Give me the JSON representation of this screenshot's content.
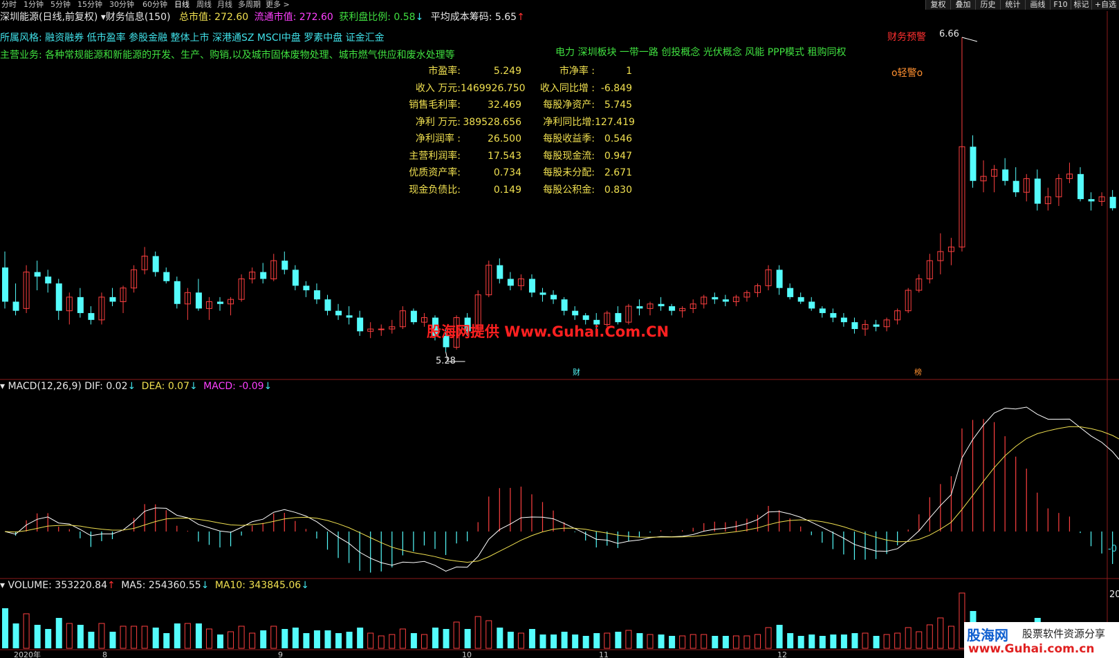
{
  "periods": [
    "分时",
    "1分钟",
    "5分钟",
    "15分钟",
    "30分钟",
    "60分钟",
    "日线",
    "周线",
    "月线",
    "多周期",
    "更多 >"
  ],
  "active_period": "日线",
  "toolbar": [
    "复权",
    "叠加",
    "历史",
    "统计",
    "画线",
    "F10",
    "标记",
    "+自选"
  ],
  "header": {
    "stock": "深圳能源(日线,前复权)",
    "finance_tab": "财务信息(150)",
    "total_mv_label": "总市值:",
    "total_mv": "272.60",
    "float_mv_label": "流通市值:",
    "float_mv": "272.60",
    "profit_ratio_label": "获利盘比例:",
    "profit_ratio": "0.58",
    "avg_cost_label": "平均成本筹码:",
    "avg_cost": "5.65",
    "arrow_down": "↓",
    "arrow_up": "↑"
  },
  "style_row": {
    "label": "所属风格:",
    "value": "融资融券 低市盈率 参股金融 整体上市 深港通SZ MSCI中盘 罗素中盘 证金汇金"
  },
  "business_row": {
    "label": "主营业务:",
    "value": "各种常规能源和新能源的开发、生产、购销,以及城市固体废物处理、城市燃气供应和废水处理等"
  },
  "concepts": "电力 深圳板块 一带一路 创投概念 光伏概念 风能 PPP模式 租购同权",
  "financials": [
    {
      "l1": "市盈率:",
      "v1": "5.249",
      "l2": "市净率 :",
      "v2": "1"
    },
    {
      "l1": "收入 万元:",
      "v1": "1469926.750",
      "l2": "收入同比增 :",
      "v2": "-6.849"
    },
    {
      "l1": "销售毛利率:",
      "v1": "32.469",
      "l2": "每股净资产:",
      "v2": "5.745"
    },
    {
      "l1": "净利 万元:",
      "v1": "389528.656",
      "l2": "净利同比增:",
      "v2": "127.419"
    },
    {
      "l1": "净利润率 :",
      "v1": "26.500",
      "l2": "每股收益季:",
      "v2": "0.546"
    },
    {
      "l1": "主营利润率:",
      "v1": "17.543",
      "l2": "每股现金流:",
      "v2": "0.947"
    },
    {
      "l1": "优质资产率:",
      "v1": "0.734",
      "l2": "每股未分配:",
      "v2": "2.671"
    },
    {
      "l1": "现金负债比:",
      "v1": "0.149",
      "l2": "每股公积金:",
      "v2": "0.830"
    }
  ],
  "annotations": {
    "warning": "财务预警",
    "high": "6.66",
    "light_warning": "o轻警o",
    "low": "5.28",
    "fin_marker": "财",
    "list_marker": "榜",
    "watermark": "股海网提供 Www.Guhai.Com.CN"
  },
  "macd": {
    "title": "MACD(12,26,9)",
    "dif_label": "DIF:",
    "dif": "0.02",
    "dea_label": "DEA:",
    "dea": "0.07",
    "macd_label": "MACD:",
    "macd": "-0.09",
    "axis": "-0"
  },
  "volume": {
    "title": "VOLUME:",
    "value": "353220.84",
    "ma5_label": "MA5:",
    "ma5": "254360.55",
    "ma10_label": "MA10:",
    "ma10": "343845.06",
    "axis": "20"
  },
  "x_axis": [
    "2020年",
    "8",
    "9",
    "10",
    "11",
    "12"
  ],
  "logo": {
    "main": "股海网",
    "slogan": "股票软件资源分享",
    "url": "www.Guhai.com.cn"
  },
  "colors": {
    "up": "#ff4040",
    "down": "#54fcfc",
    "dif": "#ffffff",
    "dea": "#f0e050",
    "macd": "#ff40ff"
  },
  "chart_data": {
    "type": "candlestick",
    "price_high": 6.66,
    "price_low": 5.28,
    "ohlc": [
      [
        5.65,
        5.72,
        5.47,
        5.5
      ],
      [
        5.5,
        5.58,
        5.44,
        5.46
      ],
      [
        5.47,
        5.66,
        5.45,
        5.63
      ],
      [
        5.63,
        5.68,
        5.55,
        5.61
      ],
      [
        5.61,
        5.64,
        5.54,
        5.58
      ],
      [
        5.58,
        5.6,
        5.42,
        5.46
      ],
      [
        5.46,
        5.54,
        5.4,
        5.52
      ],
      [
        5.52,
        5.56,
        5.43,
        5.45
      ],
      [
        5.45,
        5.48,
        5.4,
        5.42
      ],
      [
        5.42,
        5.54,
        5.4,
        5.52
      ],
      [
        5.52,
        5.56,
        5.48,
        5.5
      ],
      [
        5.5,
        5.57,
        5.45,
        5.56
      ],
      [
        5.56,
        5.66,
        5.54,
        5.64
      ],
      [
        5.64,
        5.74,
        5.62,
        5.7
      ],
      [
        5.7,
        5.72,
        5.61,
        5.63
      ],
      [
        5.63,
        5.65,
        5.58,
        5.59
      ],
      [
        5.59,
        5.61,
        5.47,
        5.49
      ],
      [
        5.49,
        5.56,
        5.42,
        5.54
      ],
      [
        5.54,
        5.6,
        5.46,
        5.47
      ],
      [
        5.47,
        5.52,
        5.42,
        5.5
      ],
      [
        5.5,
        5.52,
        5.46,
        5.49
      ],
      [
        5.49,
        5.52,
        5.44,
        5.51
      ],
      [
        5.51,
        5.62,
        5.5,
        5.6
      ],
      [
        5.6,
        5.65,
        5.58,
        5.63
      ],
      [
        5.63,
        5.67,
        5.58,
        5.6
      ],
      [
        5.6,
        5.71,
        5.59,
        5.68
      ],
      [
        5.68,
        5.72,
        5.62,
        5.64
      ],
      [
        5.64,
        5.66,
        5.55,
        5.57
      ],
      [
        5.57,
        5.59,
        5.52,
        5.55
      ],
      [
        5.55,
        5.58,
        5.49,
        5.51
      ],
      [
        5.51,
        5.53,
        5.44,
        5.46
      ],
      [
        5.46,
        5.49,
        5.42,
        5.44
      ],
      [
        5.44,
        5.48,
        5.4,
        5.43
      ],
      [
        5.43,
        5.46,
        5.35,
        5.37
      ],
      [
        5.37,
        5.41,
        5.34,
        5.38
      ],
      [
        5.38,
        5.4,
        5.35,
        5.38
      ],
      [
        5.38,
        5.42,
        5.36,
        5.39
      ],
      [
        5.39,
        5.48,
        5.38,
        5.46
      ],
      [
        5.46,
        5.47,
        5.4,
        5.41
      ],
      [
        5.41,
        5.45,
        5.39,
        5.43
      ],
      [
        5.43,
        5.44,
        5.33,
        5.35
      ],
      [
        5.35,
        5.38,
        5.28,
        5.3
      ],
      [
        5.3,
        5.44,
        5.29,
        5.43
      ],
      [
        5.43,
        5.45,
        5.35,
        5.37
      ],
      [
        5.37,
        5.55,
        5.36,
        5.53
      ],
      [
        5.53,
        5.68,
        5.52,
        5.66
      ],
      [
        5.66,
        5.69,
        5.58,
        5.6
      ],
      [
        5.6,
        5.63,
        5.55,
        5.57
      ],
      [
        5.57,
        5.62,
        5.55,
        5.6
      ],
      [
        5.6,
        5.62,
        5.52,
        5.54
      ],
      [
        5.54,
        5.56,
        5.5,
        5.53
      ],
      [
        5.53,
        5.55,
        5.49,
        5.51
      ],
      [
        5.51,
        5.52,
        5.44,
        5.46
      ],
      [
        5.46,
        5.48,
        5.42,
        5.44
      ],
      [
        5.44,
        5.45,
        5.4,
        5.42
      ],
      [
        5.42,
        5.45,
        5.38,
        5.4
      ],
      [
        5.4,
        5.46,
        5.39,
        5.45
      ],
      [
        5.45,
        5.48,
        5.4,
        5.41
      ],
      [
        5.41,
        5.49,
        5.4,
        5.48
      ],
      [
        5.48,
        5.51,
        5.44,
        5.47
      ],
      [
        5.47,
        5.5,
        5.44,
        5.49
      ],
      [
        5.49,
        5.52,
        5.46,
        5.48
      ],
      [
        5.48,
        5.49,
        5.44,
        5.46
      ],
      [
        5.46,
        5.48,
        5.43,
        5.47
      ],
      [
        5.47,
        5.51,
        5.45,
        5.49
      ],
      [
        5.49,
        5.53,
        5.47,
        5.52
      ],
      [
        5.52,
        5.54,
        5.49,
        5.51
      ],
      [
        5.51,
        5.53,
        5.48,
        5.5
      ],
      [
        5.5,
        5.53,
        5.48,
        5.52
      ],
      [
        5.52,
        5.55,
        5.5,
        5.54
      ],
      [
        5.54,
        5.58,
        5.52,
        5.57
      ],
      [
        5.57,
        5.66,
        5.55,
        5.64
      ],
      [
        5.64,
        5.66,
        5.53,
        5.56
      ],
      [
        5.56,
        5.58,
        5.51,
        5.52
      ],
      [
        5.52,
        5.54,
        5.49,
        5.5
      ],
      [
        5.5,
        5.52,
        5.46,
        5.47
      ],
      [
        5.47,
        5.48,
        5.43,
        5.45
      ],
      [
        5.45,
        5.47,
        5.41,
        5.43
      ],
      [
        5.43,
        5.45,
        5.39,
        5.41
      ],
      [
        5.41,
        5.43,
        5.36,
        5.38
      ],
      [
        5.38,
        5.42,
        5.35,
        5.4
      ],
      [
        5.4,
        5.42,
        5.37,
        5.39
      ],
      [
        5.39,
        5.43,
        5.37,
        5.42
      ],
      [
        5.42,
        5.47,
        5.4,
        5.46
      ],
      [
        5.46,
        5.56,
        5.45,
        5.55
      ],
      [
        5.55,
        5.62,
        5.54,
        5.6
      ],
      [
        5.6,
        5.71,
        5.58,
        5.68
      ],
      [
        5.68,
        5.8,
        5.62,
        5.72
      ],
      [
        5.72,
        5.78,
        5.66,
        5.74
      ],
      [
        5.74,
        6.66,
        5.72,
        6.18
      ],
      [
        6.18,
        6.23,
        6.0,
        6.03
      ],
      [
        6.03,
        6.12,
        5.98,
        6.05
      ],
      [
        6.05,
        6.1,
        5.98,
        6.08
      ],
      [
        6.08,
        6.13,
        6.01,
        6.03
      ],
      [
        6.03,
        6.09,
        5.96,
        5.98
      ],
      [
        5.98,
        6.06,
        5.94,
        6.04
      ],
      [
        6.04,
        6.08,
        5.9,
        5.93
      ],
      [
        5.93,
        6.0,
        5.9,
        5.96
      ],
      [
        5.96,
        6.06,
        5.92,
        6.04
      ],
      [
        6.04,
        6.11,
        6.02,
        6.06
      ],
      [
        6.06,
        6.09,
        5.94,
        5.95
      ],
      [
        5.95,
        5.98,
        5.9,
        5.94
      ],
      [
        5.94,
        5.98,
        5.92,
        5.96
      ],
      [
        5.96,
        5.99,
        5.9,
        5.91
      ],
      [
        5.91,
        5.93,
        5.83,
        5.84
      ]
    ]
  }
}
